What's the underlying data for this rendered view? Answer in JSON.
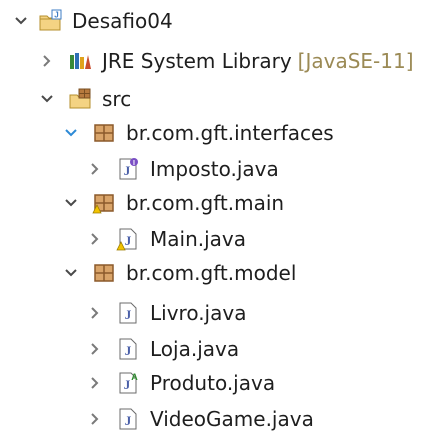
{
  "tree": {
    "project": {
      "label": "Desafio04",
      "icon": "java-project-icon"
    },
    "library": {
      "label": "JRE System Library",
      "decoration": "[JavaSE-11]",
      "icon": "library-icon"
    },
    "src": {
      "label": "src",
      "icon": "source-folder-icon"
    },
    "packages": [
      {
        "label": "br.com.gft.interfaces",
        "icon": "package-icon"
      },
      {
        "label": "br.com.gft.main",
        "icon": "package-warning-icon"
      },
      {
        "label": "br.com.gft.model",
        "icon": "package-icon"
      }
    ],
    "files": [
      {
        "label": "Imposto.java",
        "icon": "java-interface-file-icon"
      },
      {
        "label": "Main.java",
        "icon": "java-file-warning-icon"
      },
      {
        "label": "Livro.java",
        "icon": "java-file-icon"
      },
      {
        "label": "Loja.java",
        "icon": "java-file-icon"
      },
      {
        "label": "Produto.java",
        "icon": "java-abstract-file-icon"
      },
      {
        "label": "VideoGame.java",
        "icon": "java-file-icon"
      }
    ],
    "colors": {
      "twisty": "#4a4a4a",
      "twisty_selected": "#2d8ad6",
      "package": "#8b5a2b",
      "decoration": "#9b8a55"
    }
  }
}
